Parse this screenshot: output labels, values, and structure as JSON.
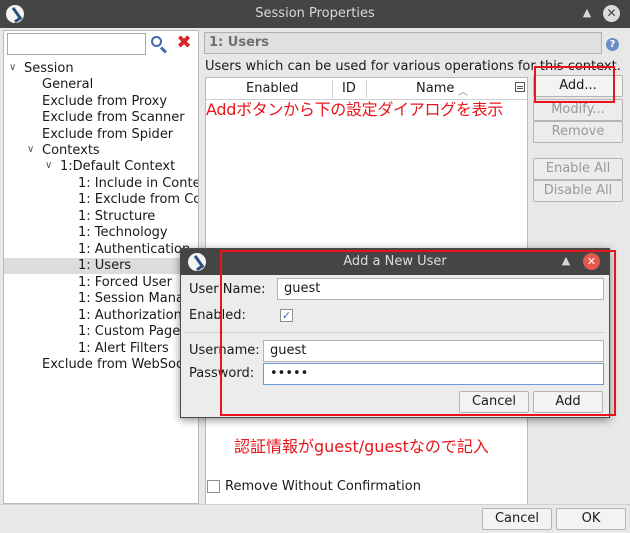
{
  "window": {
    "title": "Session Properties"
  },
  "left": {
    "filter_value": "",
    "tree": [
      "Session",
      "General",
      "Exclude from Proxy",
      "Exclude from Scanner",
      "Exclude from Spider",
      "Contexts",
      "1:Default Context",
      "1: Include in Context",
      "1: Exclude from Context",
      "1: Structure",
      "1: Technology",
      "1: Authentication",
      "1: Users",
      "1: Forced User",
      "1: Session Management",
      "1: Authorization",
      "1: Custom Page",
      "1: Alert Filters",
      "Exclude from WebSockets"
    ]
  },
  "right": {
    "context_title": "1: Users",
    "description": "Users which can be used for various operations for this context.",
    "columns": [
      "Enabled",
      "ID",
      "Name"
    ],
    "buttons": {
      "add": "Add...",
      "modify": "Modify...",
      "remove": "Remove",
      "enable_all": "Enable All",
      "disable_all": "Disable All"
    },
    "remove_without_confirmation": "Remove Without Confirmation"
  },
  "footer": {
    "cancel": "Cancel",
    "ok": "OK"
  },
  "dialog": {
    "title": "Add a New User",
    "user_name_label": "User Name:",
    "user_name_value": "guest",
    "enabled_label": "Enabled:",
    "enabled_checked": true,
    "username_label": "Username:",
    "username_value": "guest",
    "password_label": "Password:",
    "password_value": "•••••",
    "cancel": "Cancel",
    "add": "Add"
  },
  "annotations": {
    "top": "Addボタンから下の設定ダイアログを表示",
    "bottom": "認証情報がguest/guestなので記入"
  },
  "colors": {
    "annotation": "#e8141c",
    "titlebar": "#454545"
  }
}
